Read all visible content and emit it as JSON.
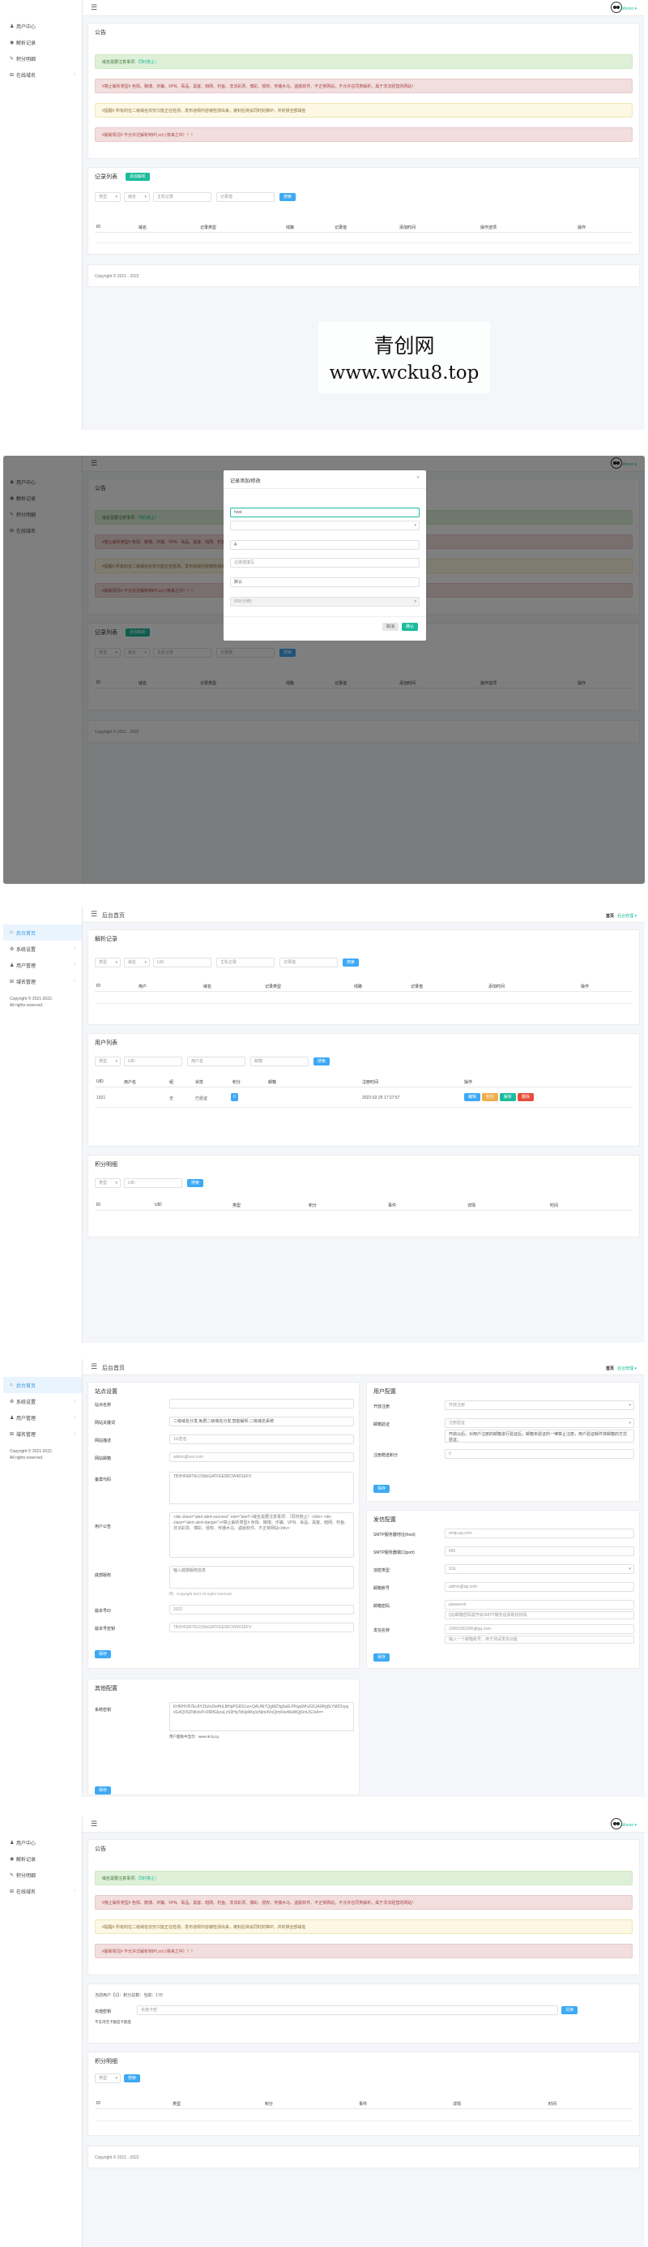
{
  "sidebar_user": {
    "items": [
      {
        "icon": "user-icon",
        "glyph": "♟",
        "label": "用户中心"
      },
      {
        "icon": "globe-icon",
        "glyph": "◉",
        "label": "解析记录"
      },
      {
        "icon": "pencil-icon",
        "glyph": "✎",
        "label": "积分明细"
      },
      {
        "icon": "grid-icon",
        "glyph": "⊞",
        "label": "在线域名",
        "arrow": "‹"
      }
    ]
  },
  "sidebar_admin": {
    "items": [
      {
        "icon": "home-icon",
        "glyph": "⌂",
        "label": "后台首页"
      },
      {
        "icon": "gear-icon",
        "glyph": "⚙",
        "label": "系统设置",
        "arrow": "‹"
      },
      {
        "icon": "users-icon",
        "glyph": "♟",
        "label": "用户管理",
        "arrow": "‹"
      },
      {
        "icon": "grid-icon",
        "glyph": "⊞",
        "label": "域名管理",
        "arrow": "‹"
      }
    ],
    "copyright": "Copyright © 2021-2022.",
    "rights": "All rights reserved."
  },
  "topbar": {
    "user_link": "Monzo ▾",
    "admin_title": "后台首页",
    "home_label": "首页",
    "admin_link": "后台管理 ▾"
  },
  "notice": {
    "title": "公告",
    "green_lead": "域名需要注意事项：",
    "green_em": "同时禁止）",
    "red1": "#禁止解析类型# 色情、赌博、诈骗、VPN、毒品、黑客、暗网、钓鱼、非法彩票、博彩、侵权、传播木马、盗版软件、不正常网站，不允许在同类解析，属于非法经营的网站！",
    "yellow": "#提醒# 所有的在二级域名仅仅只能正在检测，发布违规内容被检测出来，被封后将会同时封禁IP，并封禁全部域名",
    "red2": "#最新情况# 不允许泛解析到IP(.cn) (将来之中）！！"
  },
  "records": {
    "title": "记录列表",
    "add_label": "添加解析",
    "type_select": "类型",
    "domain_select": "域名",
    "host_placeholder": "主机记录",
    "value_placeholder": "记录值",
    "search_label": "搜索",
    "cols": [
      "ID",
      "域名",
      "记录类型",
      "线路",
      "记录值",
      "添加时间",
      "操作选项",
      "操作"
    ]
  },
  "footer": {
    "copyright": "Copyright © 2021 - 2022"
  },
  "watermark": {
    "cn": "青创网",
    "url": "www.wcku8.top"
  },
  "modal": {
    "title": "记录添加/修改",
    "host_value": "host",
    "type_value": "A",
    "value_placeholder": "记录值填写",
    "line_value": "默认",
    "ttl_value": "600(分钟)",
    "cancel_label": "取消",
    "confirm_label": "确认"
  },
  "admin": {
    "records_card": {
      "title": "解析记录",
      "type_select": "类型",
      "domain_select": "域名",
      "uid_placeholder": "UID",
      "host_placeholder": "主机记录",
      "value_placeholder": "记录值",
      "search_label": "搜索",
      "cols": [
        "ID",
        "用户",
        "域名",
        "记录类型",
        "线路",
        "记录值",
        "添加时间",
        "操作"
      ]
    },
    "users_card": {
      "title": "用户列表",
      "select": "类型",
      "uid_placeholder": "UID",
      "name_placeholder": "用户名",
      "mail_placeholder": "邮箱",
      "search_label": "搜索",
      "cols": [
        "UID",
        "用户名",
        "组",
        "状态",
        "积分",
        "邮箱",
        "注册时间",
        "操作"
      ],
      "row": {
        "uid": "1021",
        "name": "",
        "group": "无",
        "status": "已验证",
        "points": "0",
        "email": "",
        "time": "2022-02-25 17:27:57",
        "actions": [
          "编辑",
          "积分",
          "解析",
          "删除"
        ]
      }
    },
    "points_card": {
      "title": "积分明细",
      "select": "类型",
      "uid_placeholder": "UID",
      "search_label": "搜索",
      "cols": [
        "ID",
        "UID",
        "类型",
        "积分",
        "事件",
        "详情",
        "时间"
      ]
    }
  },
  "settings": {
    "site_card": {
      "title": "站点设置",
      "fields": [
        {
          "label": "站点名称",
          "value": ""
        },
        {
          "label": "网站关键词",
          "value": "二级域名分发,免费二级域名分发,智能解析,二级域名系统"
        },
        {
          "label": "网站描述",
          "value": "1G签名"
        },
        {
          "label": "网站邮箱",
          "value": "admin@xxx.com"
        },
        {
          "label": "备案代码",
          "value": "TB2HFEBT6LDS8xGATFEE9DCW4D1EFV"
        }
      ],
      "notice_label": "用户公告",
      "notice_value": "<div class=\"alert alert-success\" role=\"alert\">域名需要注意事项：（同时禁止）</div> <div class=\"alert alert-danger\">#禁止解析类型# 色情、赌博、诈骗、VPN、毒品、黑客、暗网、钓鱼、非法彩票、博彩、侵权、传播木马、盗版软件、不正常网站</div>",
      "footer_label": "底部版权",
      "footer_value": "输入底部版权信息",
      "footer_hint": "例：Copyright 2021 All rights reserved.",
      "callback_label": "版本号ID",
      "callback_value": "2022",
      "key_label": "版本号密钥",
      "key_value": "TB2HFEBT6LDS8xGATFEE9DCW4D1EFV",
      "save_label": "保存"
    },
    "user_card": {
      "title": "用户配置",
      "fields": [
        {
          "label": "开放注册",
          "value": "开放注册"
        },
        {
          "label": "邮箱验证",
          "value": "注册验证"
        },
        {
          "label": "注册赠送积分",
          "value": "0"
        }
      ],
      "mail_desc": "开启以后，对用户注册的邮箱进行验证后，邮箱未验证的一律禁止注册，用户验证邮件将邮箱的方式验证。",
      "save_label": "保存"
    },
    "smtp_card": {
      "title": "发信配置",
      "fields": [
        {
          "label": "SMTP服务器地址(host)",
          "value": "smtp.qq.com"
        },
        {
          "label": "SMTP服务器端口(port)",
          "value": "465"
        },
        {
          "label": "加密类型",
          "value": "SSL"
        },
        {
          "label": "邮箱账号",
          "value": "admin@qq.com"
        },
        {
          "label": "邮箱密码",
          "value": "password"
        },
        {
          "label": "发信名称",
          "value": "10001002345@qq.com"
        }
      ],
      "pass_hint": "QQ邮箱密码需开启SMTP服务后获取授权码",
      "test_hint": "输入一个邮箱账号，用于测试发信功能",
      "save_label": "保存"
    },
    "other_card": {
      "title": "其他配置",
      "label": "系统密钥",
      "value": "KHRHVR7Ec8YZbXvDe4fnLBHpPGRS1zi+QAUNl7QgMZ9g3a6LPRgaWhJG5JA0Rg8LYM22oyqvG4QV6ZNKdxP+f3RfGbzaLzS9Hq7bNjdWq3zNjm4VoQ/mKtwWa8tQj6mUSJxA==",
      "hint": "用户面板中显示：www.ik.bj.cq",
      "save_label": "保存"
    }
  },
  "points_page": {
    "info": "当前用户【1】：积分总数：当前：170",
    "label": "充值密钥",
    "placeholder": "充值卡密",
    "note": "不支持无卡额度卡额度",
    "submit_label": "兑换",
    "list_title": "积分明细",
    "select": "类型",
    "search_label": "搜索",
    "cols": [
      "ID",
      "类型",
      "积分",
      "事件",
      "详情",
      "时间"
    ]
  }
}
